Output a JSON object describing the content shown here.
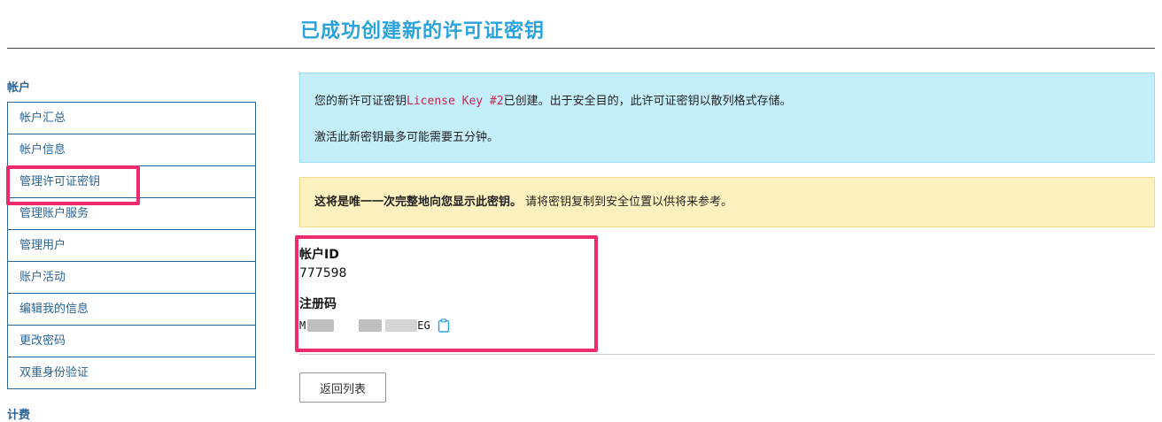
{
  "page": {
    "title": "已成功创建新的许可证密钥"
  },
  "sidebar": {
    "heading": "帐户",
    "items": [
      {
        "label": "帐户汇总"
      },
      {
        "label": "帐户信息"
      },
      {
        "label": "管理许可证密钥"
      },
      {
        "label": "管理账户服务"
      },
      {
        "label": "管理用户"
      },
      {
        "label": "账户活动"
      },
      {
        "label": "编辑我的信息"
      },
      {
        "label": "更改密码"
      },
      {
        "label": "双重身份验证"
      }
    ],
    "next_heading": "计费"
  },
  "info_box": {
    "line1_prefix": "您的新许可证密钥",
    "key_name": "License Key #2",
    "line1_suffix": "已创建。出于安全目的，此许可证密钥以散列格式存储。",
    "line2": "激活此新密钥最多可能需要五分钟。"
  },
  "warning_box": {
    "bold_text": "这将是唯一一次完整地向您显示此密钥。",
    "text": "请将密钥复制到安全位置以供将来参考。"
  },
  "account": {
    "id_label": "帐户ID",
    "id_value": "777598",
    "reg_label": "注册码",
    "reg_prefix": "M",
    "reg_suffix": "EG"
  },
  "buttons": {
    "back_label": "返回列表"
  },
  "icons": {
    "copy": "clipboard-icon"
  },
  "colors": {
    "accent": "#2aa3dd",
    "link": "#2a6496",
    "highlight": "#ee2a6b",
    "info_bg": "#c5eefb",
    "warn_bg": "#fdf1bf"
  }
}
